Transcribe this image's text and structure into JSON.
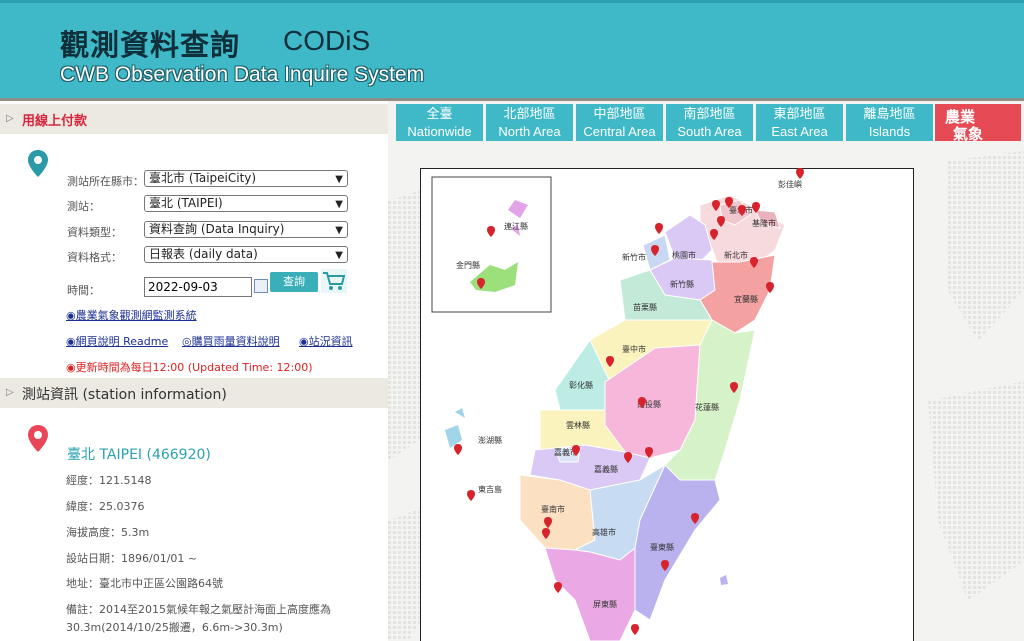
{
  "header": {
    "title_zh": "觀測資料查詢",
    "title_codis": "CODiS",
    "subtitle_en": "CWB Observation Data Inquire System"
  },
  "left_panel": {
    "section1_title": "用線上付款",
    "form": {
      "county_label": "測站所在縣市：",
      "county_value": "臺北市 (TaipeiCity)",
      "station_label": "測站：",
      "station_value": "臺北 (TAIPEI)",
      "data_type_label": "資料類型：",
      "data_type_value": "資料查詢 (Data Inquiry)",
      "data_format_label": "資料格式：",
      "data_format_value": "日報表 (daily data)",
      "time_label": "時間：",
      "date_value": "2022-09-03",
      "query_button": "查詢"
    },
    "links": {
      "agri_network": "◉農業氣象觀測網監測系統",
      "readme": "◉網頁說明 Readme",
      "rainfall_purchase": "◎購買雨量資料說明",
      "station_info": "◉站況資訊"
    },
    "update_note": "◉更新時間為每日12:00 (Updated Time: 12:00)",
    "section2_title": "測站資訊 (station information)",
    "station": {
      "name": "臺北 TAIPEI (466920)",
      "longitude": "經度：121.5148",
      "latitude": "緯度：25.0376",
      "altitude": "海拔高度：5.3m",
      "established": "設站日期：1896/01/01 ~",
      "address": "地址：臺北市中正區公園路64號",
      "remark_line1": "備註：2014至2015氣候年報之氣壓計海面上高度應為",
      "remark_line2": "30.3m(2014/10/25搬遷，6.6m->30.3m)"
    }
  },
  "tabs": [
    {
      "zh": "全臺",
      "en": "Nationwide"
    },
    {
      "zh": "北部地區",
      "en": "North Area"
    },
    {
      "zh": "中部地區",
      "en": "Central Area"
    },
    {
      "zh": "南部地區",
      "en": "South Area"
    },
    {
      "zh": "東部地區",
      "en": "East Area"
    },
    {
      "zh": "離島地區",
      "en": "Islands"
    }
  ],
  "agri_tab": {
    "line1": "農業",
    "line2": "氣象"
  },
  "map": {
    "counties": {
      "pengjiayu": "彭佳嶼",
      "keelung": "基隆市",
      "taipei": "臺北市",
      "new_taipei": "新北市",
      "taoyuan": "桃園市",
      "hsinchu_city": "新竹市",
      "hsinchu_county": "新竹縣",
      "yilan": "宜蘭縣",
      "miaoli": "苗栗縣",
      "taichung": "臺中市",
      "changhua": "彰化縣",
      "nantou": "南投縣",
      "hualien": "花蓮縣",
      "yunlin": "雲林縣",
      "chiayi_city": "嘉義市",
      "chiayi_county": "嘉義縣",
      "penghu": "澎湖縣",
      "tainan": "臺南市",
      "kaohsiung": "高雄市",
      "taitung": "臺東縣",
      "pingtung": "屏東縣",
      "lanyu": "東吉島",
      "lienchiang": "連江縣",
      "kinmen": "金門縣"
    }
  }
}
